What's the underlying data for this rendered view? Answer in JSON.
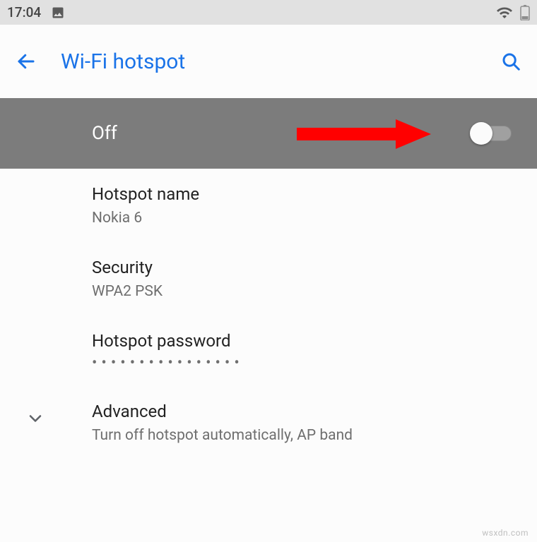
{
  "statusbar": {
    "time": "17:04"
  },
  "appbar": {
    "title": "Wi-Fi hotspot"
  },
  "toggle": {
    "label": "Off"
  },
  "settings": {
    "hotspot_name": {
      "title": "Hotspot name",
      "value": "Nokia 6"
    },
    "security": {
      "title": "Security",
      "value": "WPA2 PSK"
    },
    "password": {
      "title": "Hotspot password",
      "value": "••••••••••••••••"
    },
    "advanced": {
      "title": "Advanced",
      "value": "Turn off hotspot automatically, AP band"
    }
  },
  "attribution": "wsxdn.com"
}
